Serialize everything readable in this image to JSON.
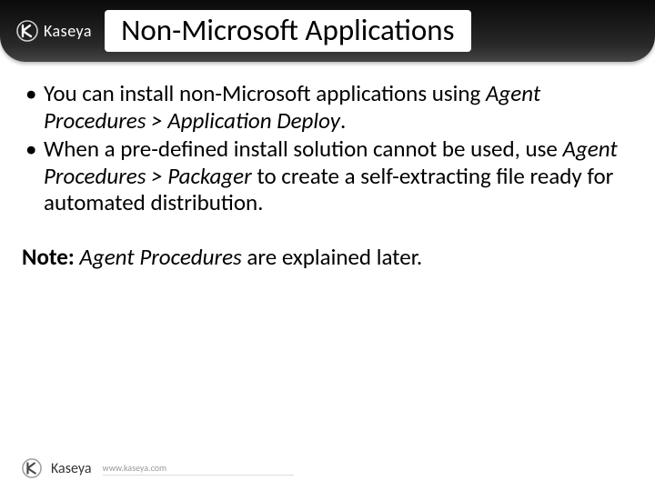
{
  "header": {
    "brand": "Kaseya",
    "title": "Non-Microsoft Applications"
  },
  "bullets": [
    {
      "pre": "You can install non-Microsoft applications using ",
      "em": "Agent Procedures > Application Deploy",
      "post": "."
    },
    {
      "pre": "When a pre-defined install solution cannot be used, use ",
      "em": "Agent Procedures > Packager",
      "post": " to create a self-extracting file ready for automated distribution."
    }
  ],
  "note": {
    "label": "Note:",
    "em": "Agent Procedures",
    "post": " are explained later."
  },
  "footer": {
    "brand": "Kaseya",
    "url": "www.kaseya.com"
  }
}
